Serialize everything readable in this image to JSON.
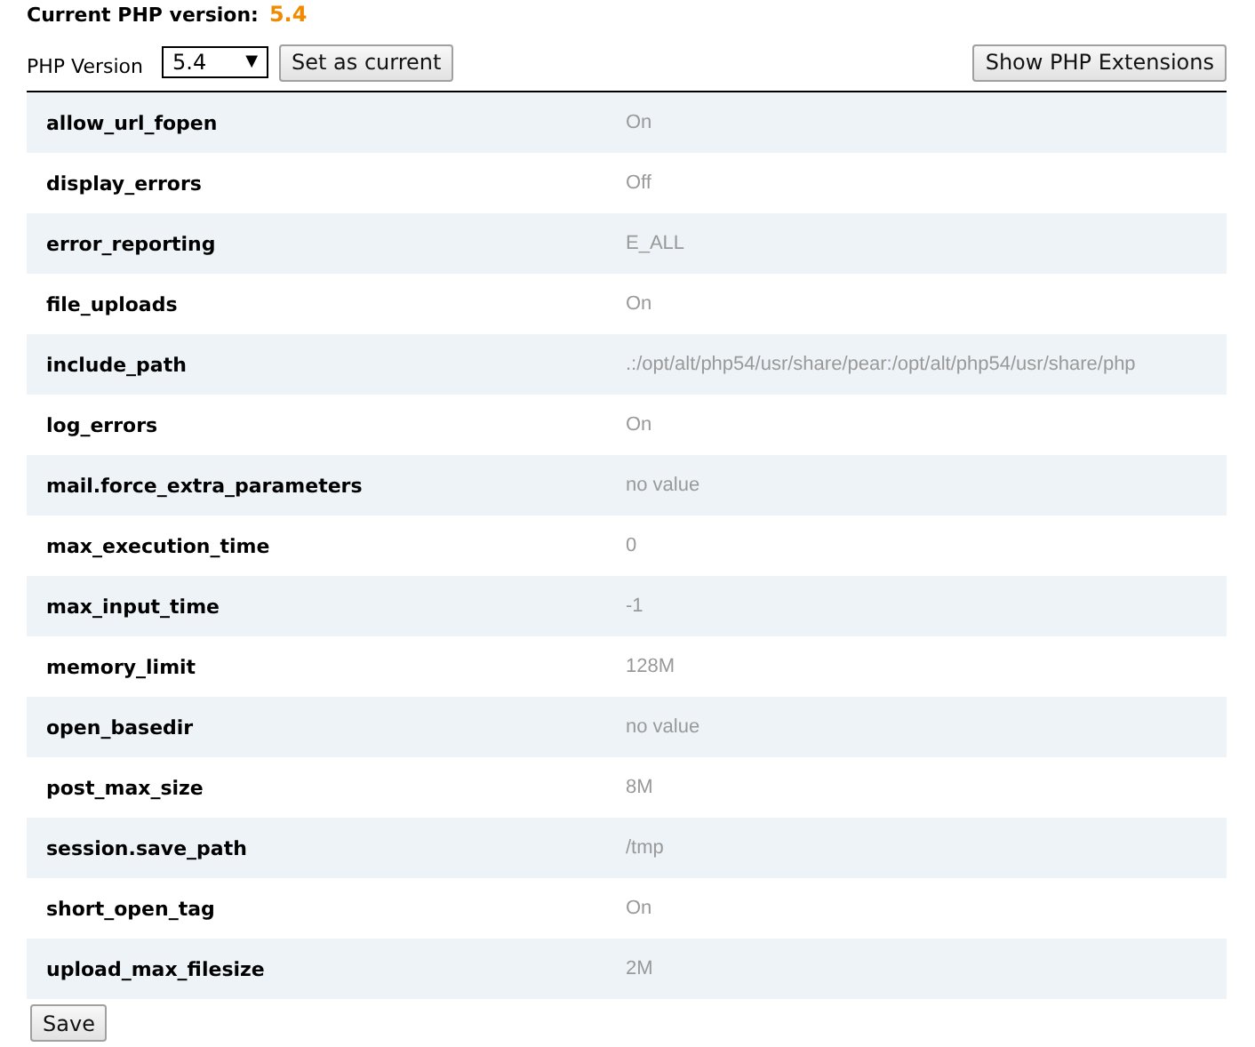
{
  "current_version": {
    "label": "Current PHP version:",
    "value": "5.4"
  },
  "selector": {
    "label": "PHP Version",
    "value": "5.4",
    "arrow": "▼"
  },
  "buttons": {
    "set_current": "Set as current",
    "show_extensions": "Show PHP Extensions",
    "save": "Save"
  },
  "options": [
    {
      "name": "allow_url_fopen",
      "value": "On"
    },
    {
      "name": "display_errors",
      "value": "Off"
    },
    {
      "name": "error_reporting",
      "value": "E_ALL"
    },
    {
      "name": "file_uploads",
      "value": "On"
    },
    {
      "name": "include_path",
      "value": ".:/opt/alt/php54/usr/share/pear:/opt/alt/php54/usr/share/php"
    },
    {
      "name": "log_errors",
      "value": "On"
    },
    {
      "name": "mail.force_extra_parameters",
      "value": "no value"
    },
    {
      "name": "max_execution_time",
      "value": "0"
    },
    {
      "name": "max_input_time",
      "value": "-1"
    },
    {
      "name": "memory_limit",
      "value": "128M"
    },
    {
      "name": "open_basedir",
      "value": "no value"
    },
    {
      "name": "post_max_size",
      "value": "8M"
    },
    {
      "name": "session.save_path",
      "value": "/tmp"
    },
    {
      "name": "short_open_tag",
      "value": "On"
    },
    {
      "name": "upload_max_filesize",
      "value": "2M"
    }
  ]
}
